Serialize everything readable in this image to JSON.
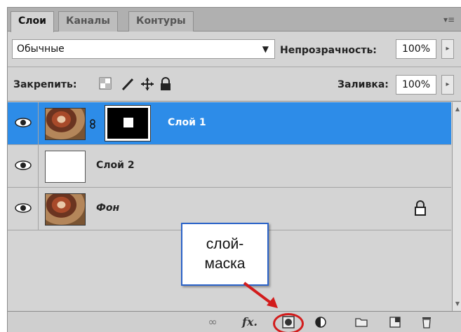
{
  "tabs": [
    {
      "label": "Слои",
      "active": true
    },
    {
      "label": "Каналы",
      "active": false
    },
    {
      "label": "Контуры",
      "active": false
    }
  ],
  "panel_menu_icon": "panel-menu-icon",
  "blend": {
    "mode": "Обычные",
    "opacity_label": "Непрозрачность:",
    "opacity_value": "100%"
  },
  "lock": {
    "label": "Закрепить:",
    "icons": [
      "lock-transparent-icon",
      "lock-brush-icon",
      "lock-move-icon",
      "lock-all-icon"
    ],
    "fill_label": "Заливка:",
    "fill_value": "100%"
  },
  "layers": [
    {
      "name": "Слой 1",
      "selected": true,
      "thumb": "photo",
      "has_mask": true
    },
    {
      "name": "Слой 2",
      "selected": false,
      "thumb": "white",
      "has_mask": false
    },
    {
      "name": "Фон",
      "selected": false,
      "thumb": "photo",
      "locked": true
    }
  ],
  "toolbar": {
    "icons": [
      "link-layers-icon",
      "fx-icon",
      "add-mask-icon",
      "adjustment-icon",
      "group-icon",
      "new-layer-icon",
      "trash-icon"
    ],
    "fx_label": "fx"
  },
  "callout": {
    "line1": "слой-",
    "line2": "маска"
  },
  "colors": {
    "selection": "#2d8ce8",
    "highlight": "#d21c1c",
    "callout_border": "#2b63c8"
  }
}
